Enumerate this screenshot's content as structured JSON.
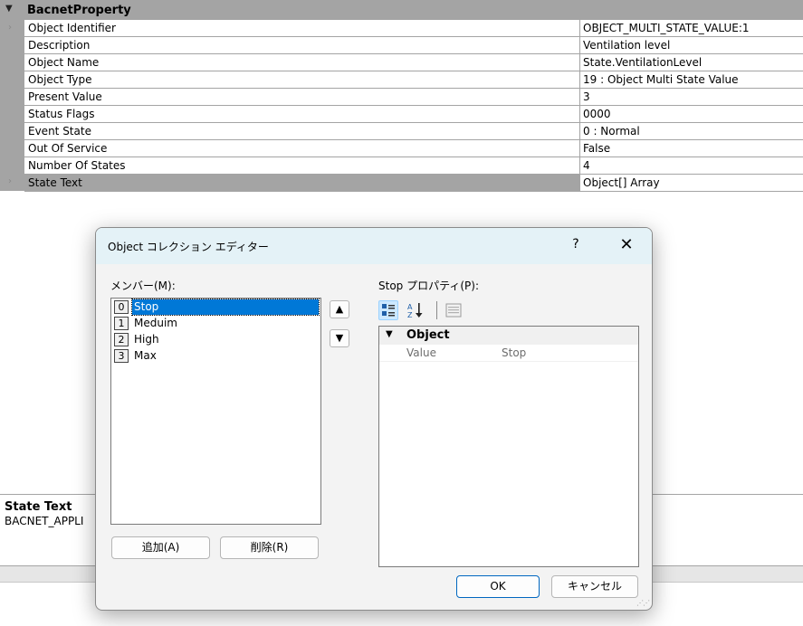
{
  "property_grid": {
    "category": "BacnetProperty",
    "rows": [
      {
        "name": "Object Identifier",
        "value": "OBJECT_MULTI_STATE_VALUE:1"
      },
      {
        "name": "Description",
        "value": "Ventilation level"
      },
      {
        "name": "Object Name",
        "value": "State.VentilationLevel"
      },
      {
        "name": "Object Type",
        "value": "19 : Object Multi State Value"
      },
      {
        "name": "Present Value",
        "value": "3"
      },
      {
        "name": "Status Flags",
        "value": "0000"
      },
      {
        "name": "Event State",
        "value": "0 : Normal"
      },
      {
        "name": "Out Of Service",
        "value": "False"
      },
      {
        "name": "Number Of States",
        "value": "4"
      },
      {
        "name": "State Text",
        "value": "Object[] Array"
      }
    ],
    "selected_row": "State Text"
  },
  "description_panel": {
    "title": "State Text",
    "text": "BACNET_APPLI"
  },
  "dialog": {
    "title": "Object コレクション エディター",
    "help": "?",
    "close": "✕",
    "members_label": "メンバー(M):",
    "members": [
      {
        "index": "0",
        "name": "Stop"
      },
      {
        "index": "1",
        "name": "Meduim"
      },
      {
        "index": "2",
        "name": "High"
      },
      {
        "index": "3",
        "name": "Max"
      }
    ],
    "selected_member": "Stop",
    "add_button": "追加(A)",
    "remove_button": "削除(R)",
    "properties_label": "Stop プロパティ(P):",
    "prop_category": "Object",
    "prop_rows": [
      {
        "name": "Value",
        "value": "Stop"
      }
    ],
    "ok_button": "OK",
    "cancel_button": "キャンセル"
  },
  "colors": {
    "grid_gray": "#a4a4a4",
    "selection_blue": "#0078d7",
    "dialog_title_bg": "#e4f2f7"
  }
}
